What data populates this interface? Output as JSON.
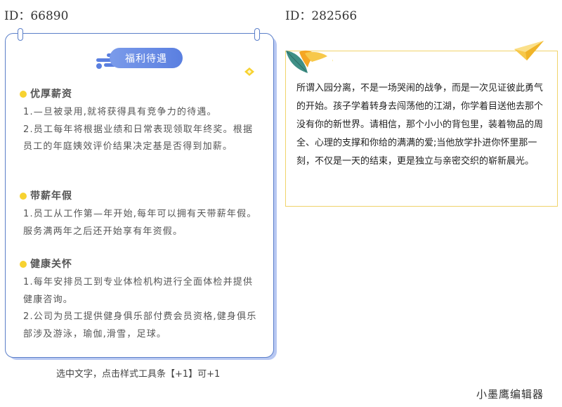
{
  "ids": {
    "left": "ID：66890",
    "right": "ID：282566"
  },
  "banner": {
    "title": "福利待遇"
  },
  "sections": [
    {
      "title": "优厚薪资",
      "lines": [
        "1.—旦被录用,就将获得具有竞争力的待遇。",
        "2.员工每年将根据业绩和日常表现领取年终奖。根据员工的年庭姨效评价结果决定基是否得到加薪。"
      ]
    },
    {
      "title": "带薪年假",
      "lines": [
        "1.员工从工作第—年开始,每年可以拥有天带薪年假。服务满两年之后还开始享有年资假。"
      ]
    },
    {
      "title": "健康关怀",
      "lines": [
        "1.每年安排员工到专业体检机构进行全面体检并提供健康咨询。",
        "2.公司为员工提供健身俱乐部付费会员资格,健身俱乐部涉及游泳，瑜伽,滑雪，足球。"
      ]
    }
  ],
  "caption": "选中文字，点击样式工具条【+1】可+1",
  "right_text": "所谓入园分离，不是一场哭闹的战争，而是一次见证彼此勇气的开始。孩子学着转身去闯荡他的江湖，你学着目送他去那个没有你的新世界。请相信，那个小小的背包里，装着物品的周全、心理的支撑和你给的满满的爱;当他放学扑进你怀里那一刻，不仅是一天的结束，更是独立与亲密交织的崭新晨光。",
  "footer": "小墨鹰编辑器",
  "colors": {
    "accent_blue": "#5a7fe0",
    "dot_yellow": "#f7d230",
    "box_border": "#f0d36a"
  },
  "icons": [
    "clip-icon",
    "diamond-icon",
    "leaf-icon",
    "paper-plane-icon"
  ]
}
